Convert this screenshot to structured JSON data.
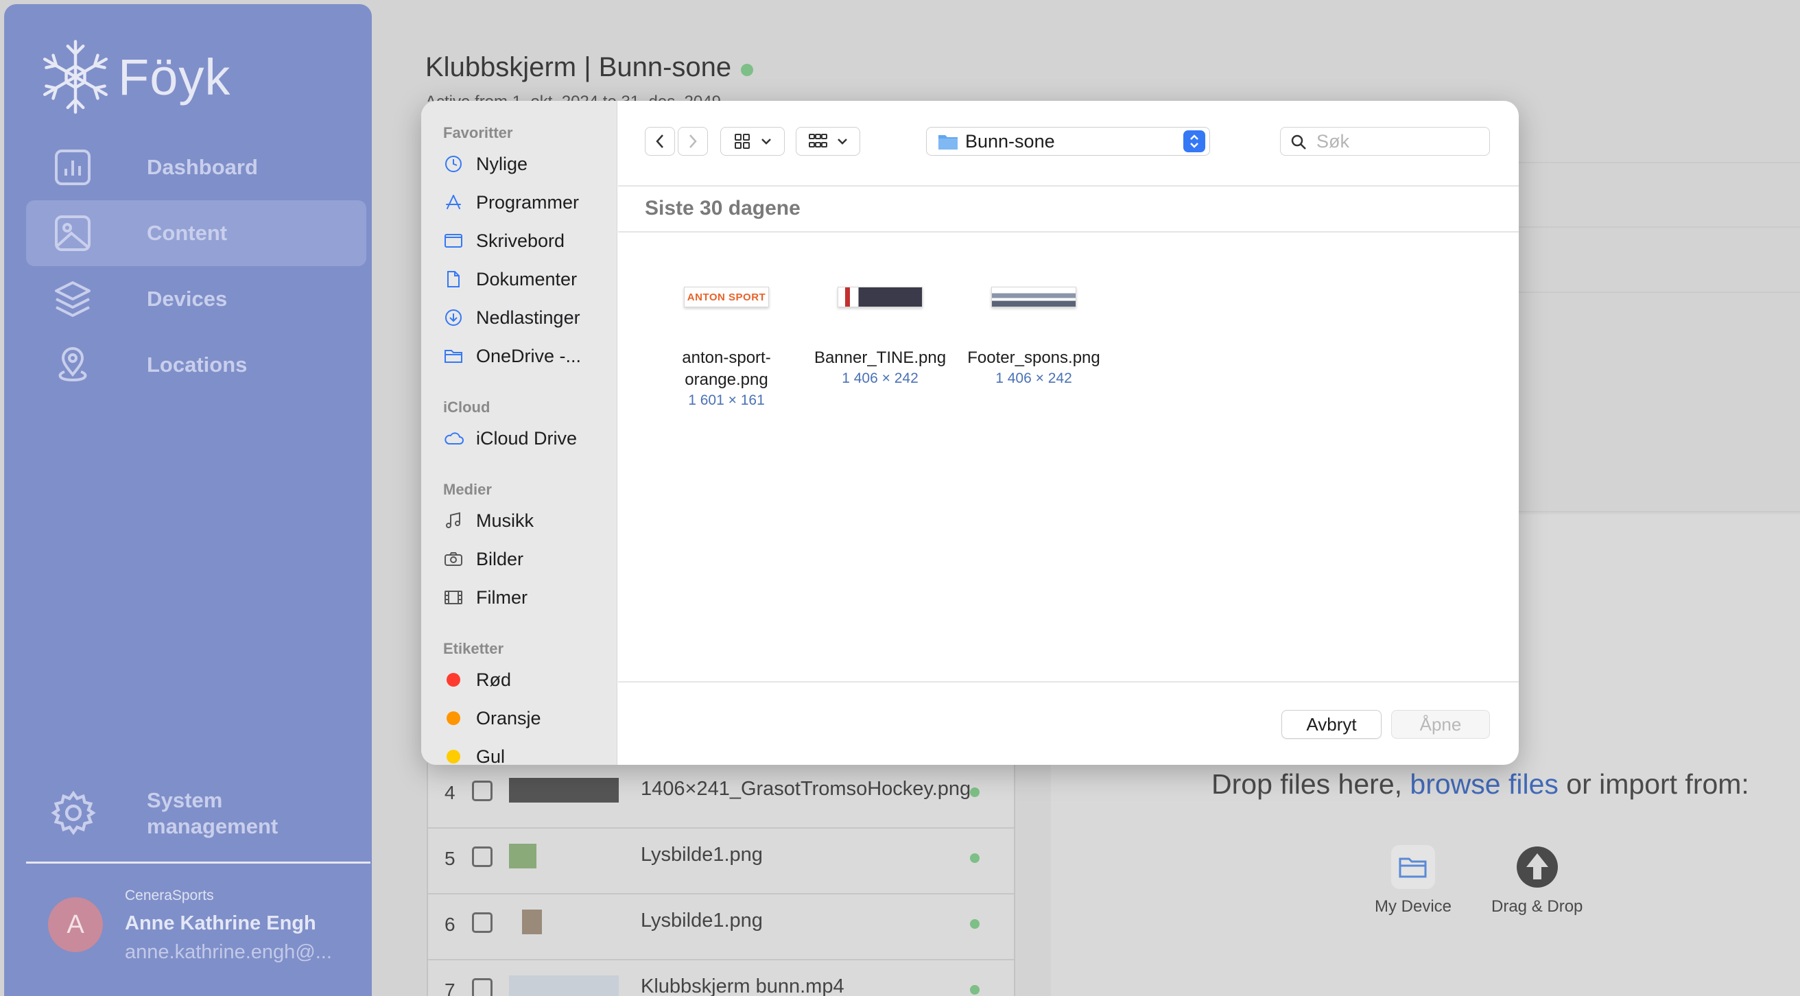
{
  "app": {
    "brand": "Föyk",
    "nav": [
      {
        "label": "Dashboard",
        "icon": "chart-icon"
      },
      {
        "label": "Content",
        "icon": "image-icon",
        "active": true
      },
      {
        "label": "Devices",
        "icon": "layers-icon"
      },
      {
        "label": "Locations",
        "icon": "location-pin-icon"
      }
    ],
    "system": {
      "label": "System management",
      "icon": "gear-icon"
    },
    "user": {
      "initial": "A",
      "org": "CeneraSports",
      "name": "Anne Kathrine Engh",
      "email": "anne.kathrine.engh@..."
    },
    "colors": {
      "sidebar": "#7f8fc9",
      "accent": "#4169b8",
      "status_green": "#7dbf87"
    }
  },
  "page": {
    "title": "Klubbskjerm | Bunn-sone",
    "subtitle": "Active from 1. okt. 2024 to 31. des. 2049"
  },
  "content_table": {
    "rows": [
      {
        "num": "4",
        "name": "1406×241_GrasotTromsoHockey.png"
      },
      {
        "num": "5",
        "name": "Lysbilde1.png"
      },
      {
        "num": "6",
        "name": "Lysbilde1.png"
      },
      {
        "num": "7",
        "name": "Klubbskjerm bunn.mp4"
      }
    ]
  },
  "upload": {
    "drop_text_1": "Drop files here, ",
    "browse_link": "browse files",
    "drop_text_2": " or import from:",
    "sources": [
      {
        "label": "My Device",
        "icon": "folder-icon"
      },
      {
        "label": "Drag & Drop",
        "icon": "upload-arrow-icon"
      }
    ]
  },
  "dialog": {
    "sidebar": {
      "favorites_title": "Favoritter",
      "favorites": [
        {
          "label": "Nylige",
          "icon": "clock-icon"
        },
        {
          "label": "Programmer",
          "icon": "apps-icon"
        },
        {
          "label": "Skrivebord",
          "icon": "desktop-icon"
        },
        {
          "label": "Dokumenter",
          "icon": "document-icon"
        },
        {
          "label": "Nedlastinger",
          "icon": "download-icon"
        },
        {
          "label": "OneDrive -...",
          "icon": "folder-icon"
        }
      ],
      "icloud_title": "iCloud",
      "icloud": [
        {
          "label": "iCloud Drive",
          "icon": "cloud-icon"
        }
      ],
      "media_title": "Medier",
      "media": [
        {
          "label": "Musikk",
          "icon": "music-note-icon"
        },
        {
          "label": "Bilder",
          "icon": "camera-icon"
        },
        {
          "label": "Filmer",
          "icon": "film-icon"
        }
      ],
      "tags_title": "Etiketter",
      "tags": [
        {
          "label": "Rød",
          "color": "#ff3b30"
        },
        {
          "label": "Oransje",
          "color": "#ff9500"
        },
        {
          "label": "Gul",
          "color": "#ffcc00"
        }
      ]
    },
    "toolbar": {
      "location": "Bunn-sone",
      "search_placeholder": "Søk"
    },
    "group_header": "Siste 30 dagene",
    "files": [
      {
        "name": "anton-sport-orange.png",
        "dims": "1 601 × 161",
        "thumb_text": "ANTON SPORT"
      },
      {
        "name": "Banner_TINE.png",
        "dims": "1 406 × 242"
      },
      {
        "name": "Footer_spons.png",
        "dims": "1 406 × 242"
      }
    ],
    "buttons": {
      "cancel": "Avbryt",
      "open": "Åpne"
    },
    "colors": {
      "accent": "#3478f6",
      "dims_text": "#4a72b5"
    }
  }
}
